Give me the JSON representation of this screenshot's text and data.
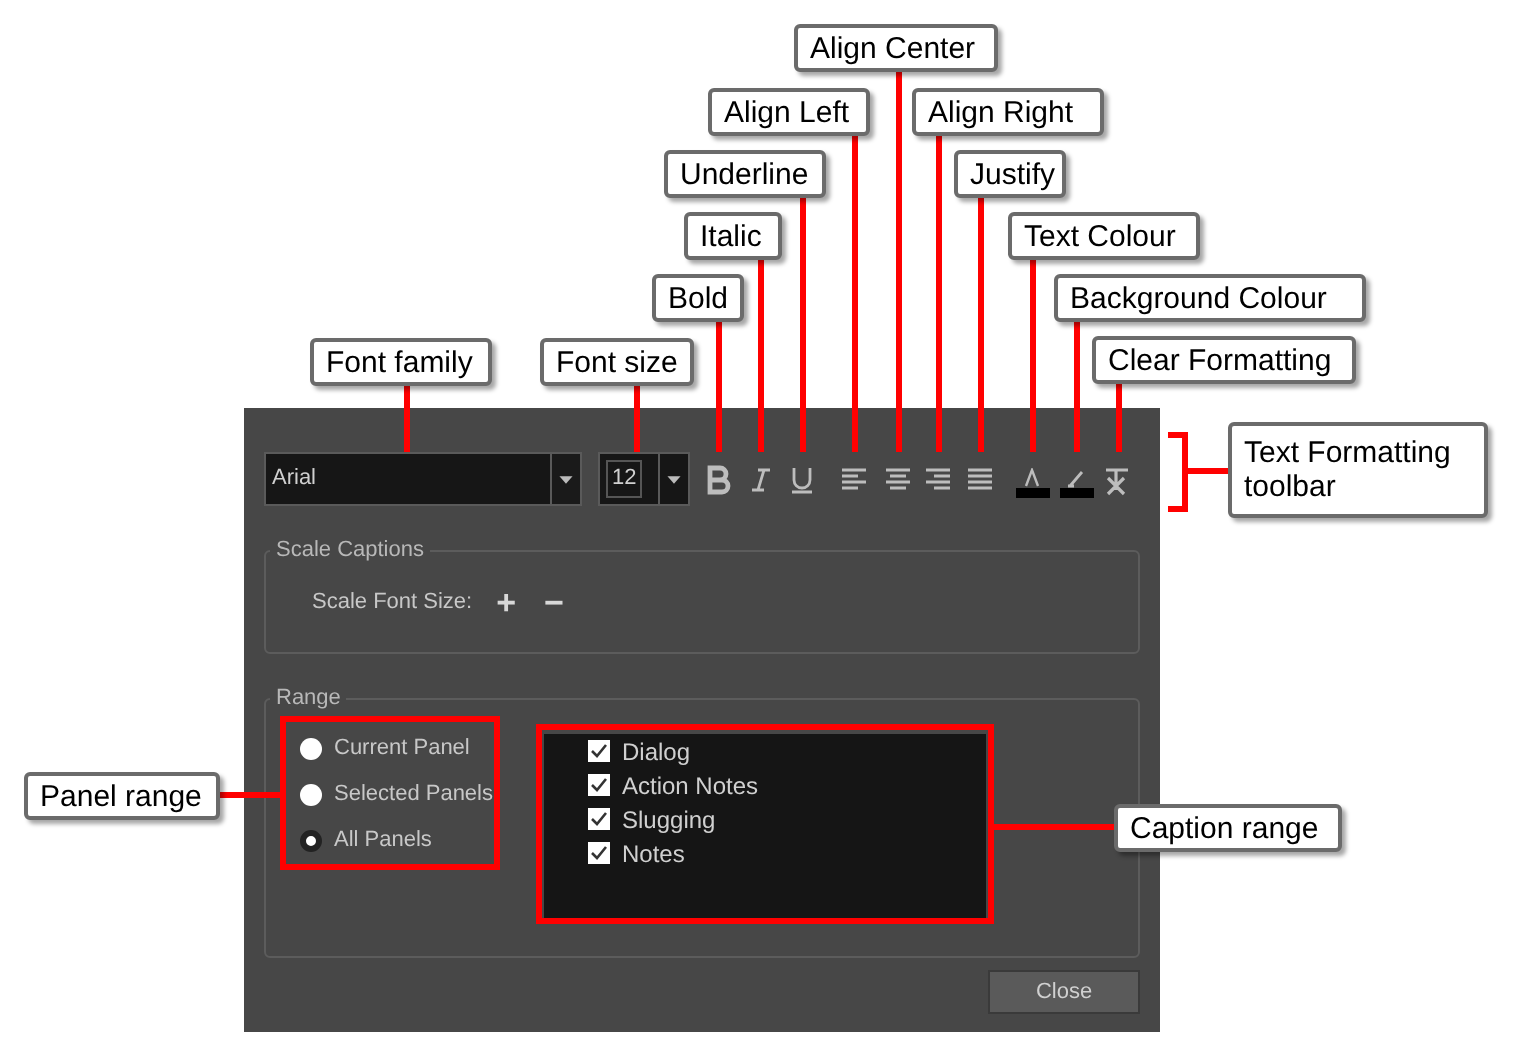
{
  "callouts": [
    {
      "label": "Align Center"
    },
    {
      "label": "Align Left"
    },
    {
      "label": "Align Right"
    },
    {
      "label": "Underline"
    },
    {
      "label": "Justify"
    },
    {
      "label": "Italic"
    },
    {
      "label": "Text Colour"
    },
    {
      "label": "Bold"
    },
    {
      "label": "Background Colour"
    },
    {
      "label": "Font family"
    },
    {
      "label": "Font size"
    },
    {
      "label": "Clear Formatting"
    },
    {
      "label": "Text Formatting toolbar"
    },
    {
      "label": "Panel range"
    },
    {
      "label": "Caption range"
    }
  ],
  "dialog": {
    "font_family": "Arial",
    "font_size": "12",
    "toolbar": [
      {
        "kind": "bold"
      },
      {
        "kind": "italic"
      },
      {
        "kind": "underline"
      },
      {
        "kind": "align-left"
      },
      {
        "kind": "align-center"
      },
      {
        "kind": "align-right"
      },
      {
        "kind": "justify"
      },
      {
        "kind": "text-colour",
        "color": "#000000"
      },
      {
        "kind": "background-colour",
        "color": "#000000"
      },
      {
        "kind": "clear"
      }
    ],
    "scale_captions": {
      "title": "Scale Captions",
      "label": "Scale Font Size:",
      "increase": "+",
      "decrease": "−"
    },
    "range": {
      "title": "Range",
      "panels": [
        {
          "label": "Current Panel",
          "selected": false
        },
        {
          "label": "Selected Panels",
          "selected": false
        },
        {
          "label": "All Panels",
          "selected": true
        }
      ],
      "captions": [
        {
          "label": "Dialog",
          "checked": true
        },
        {
          "label": "Action Notes",
          "checked": true
        },
        {
          "label": "Slugging",
          "checked": true
        },
        {
          "label": "Notes",
          "checked": true
        }
      ]
    },
    "close": "Close"
  }
}
